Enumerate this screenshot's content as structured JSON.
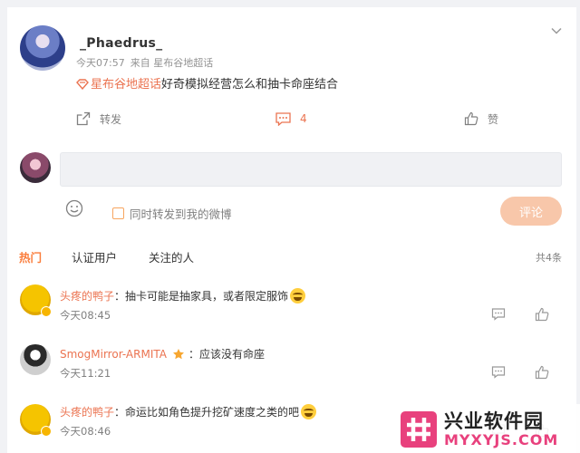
{
  "post": {
    "username": "_Phaedrus_",
    "time": "今天07:57",
    "source": "来自 星布谷地超话",
    "topic": "星布谷地超话",
    "text": "好奇模拟经营怎么和抽卡命座结合"
  },
  "actions": {
    "forward_label": "转发",
    "comment_count": "4",
    "like_label": "赞"
  },
  "composer": {
    "repost_label": "同时转发到我的微博",
    "submit_label": "评论"
  },
  "tabs": {
    "hot": "热门",
    "verified": "认证用户",
    "following": "关注的人",
    "total": "共4条"
  },
  "comments": [
    {
      "name": "头疼的鸭子",
      "text": "：抽卡可能是抽家具，或者限定服饰",
      "time": "今天08:45"
    },
    {
      "name": "SmogMirror-ARMITA",
      "text": "：应该没有命座",
      "time": "今天11:21"
    },
    {
      "name": "头疼的鸭子",
      "text": "：命运比如角色提升挖矿速度之类的吧",
      "time": "今天08:46"
    }
  ],
  "watermark": {
    "title": "兴业软件园",
    "url": "MYXYJS.COM"
  },
  "colors": {
    "accent": "#eb7350",
    "tab_active": "#fa7d3c",
    "submit_bg": "#f8c7aa",
    "watermark_pink": "#e8417d"
  }
}
